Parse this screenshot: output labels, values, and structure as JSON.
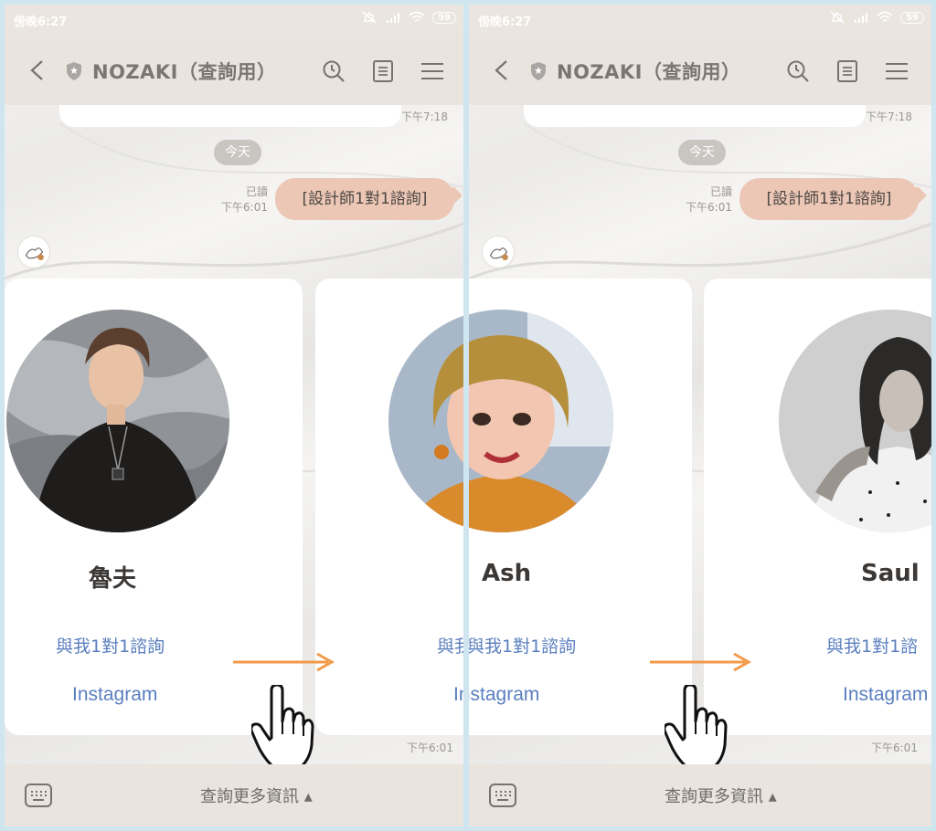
{
  "status_bar": {
    "time": "傍晚6:27",
    "battery": "59"
  },
  "header": {
    "title": "NOZAKI（查詢用）"
  },
  "chat": {
    "prev_timestamp": "下午7:18",
    "date_chip": "今天",
    "read_label": "已讀",
    "sent_time": "下午6:01",
    "my_message": "[設計師1對1諮詢]",
    "card_timestamp": "下午6:01"
  },
  "cards": [
    {
      "name": "魯夫",
      "consult_link": "與我1對1諮詢",
      "instagram_link": "Instagram"
    },
    {
      "name": "Ash",
      "consult_link": "與我1對1諮詢",
      "instagram_link": "Instagram"
    },
    {
      "name": "Saul",
      "consult_link": "與我1對1諮詢",
      "instagram_link": "Instagram"
    }
  ],
  "left_partial": {
    "consult_fragment": "與我",
    "instagram_fragment": "In"
  },
  "right_partial": {
    "consult_fragment": "與我1對1諮",
    "instagram_fragment": "Instagram"
  },
  "footer": {
    "menu_label": "查詢更多資訊 ▴"
  },
  "colors": {
    "accent_arrow": "#f19a4a",
    "link": "#5b7fbf",
    "bubble": "#ecc7b5"
  }
}
